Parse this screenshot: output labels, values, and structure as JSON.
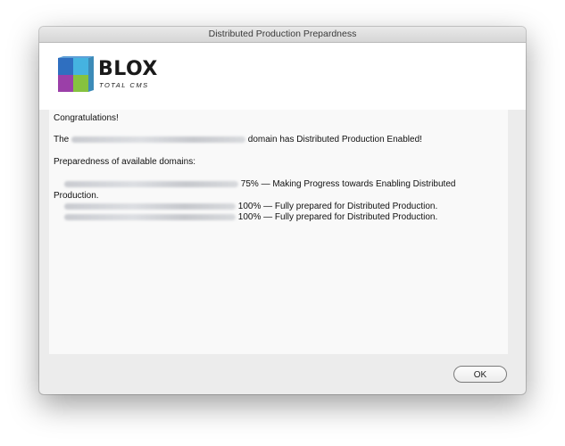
{
  "window": {
    "title": "Distributed Production Prepardness"
  },
  "logo": {
    "word": "BLOX",
    "sub": "TOTAL CMS",
    "colors": [
      "#2f6fc0",
      "#45b3e0",
      "#86c23f",
      "#9b3fa8",
      "#c23f8c"
    ]
  },
  "message": {
    "congrats": "Congratulations!",
    "domain_prefix": "The",
    "domain_suffix": "domain has Distributed Production Enabled!",
    "preparedness_heading": "Preparedness of available domains:",
    "domains": [
      {
        "status_line1": "75% — Making Progress towards Enabling Distributed",
        "status_line2": "Production."
      },
      {
        "status_line1": "100% — Fully prepared for Distributed Production."
      },
      {
        "status_line1": "100% — Fully prepared for Distributed Production."
      }
    ]
  },
  "buttons": {
    "ok": "OK"
  }
}
